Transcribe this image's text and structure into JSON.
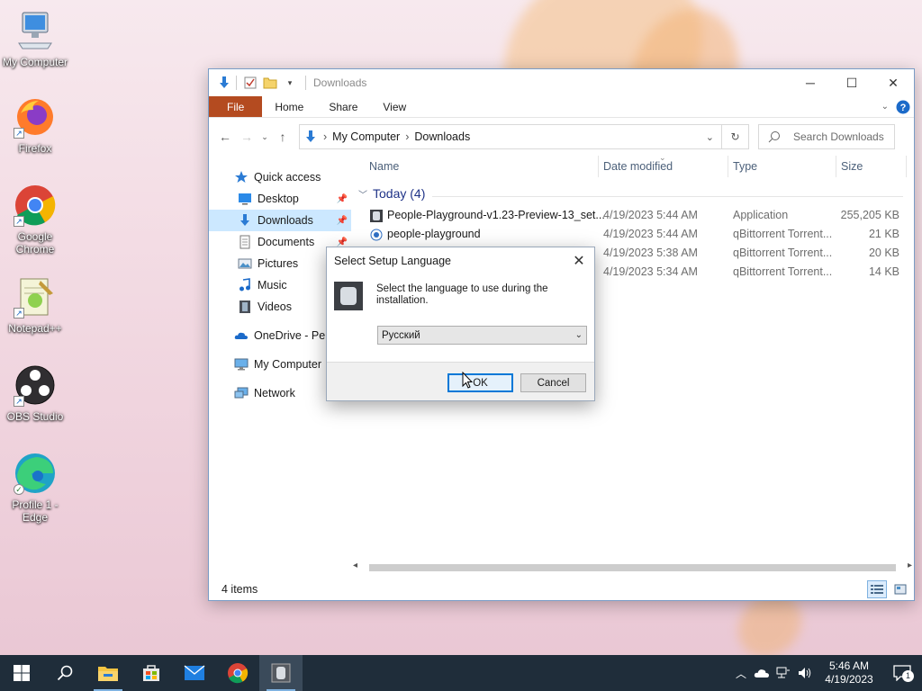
{
  "desktop": {
    "icons": [
      {
        "name": "my-computer",
        "label": "My Computer"
      },
      {
        "name": "firefox",
        "label": "Firefox"
      },
      {
        "name": "google-chrome",
        "label": "Google Chrome"
      },
      {
        "name": "notepadpp",
        "label": "Notepad++"
      },
      {
        "name": "obs-studio",
        "label": "OBS Studio"
      },
      {
        "name": "edge",
        "label": "Profile 1 - Edge"
      }
    ]
  },
  "explorer": {
    "title": "Downloads",
    "tabs": {
      "file": "File",
      "home": "Home",
      "share": "Share",
      "view": "View"
    },
    "address": {
      "root": "My Computer",
      "current": "Downloads"
    },
    "search_placeholder": "Search Downloads",
    "nav": {
      "quick_access": "Quick access",
      "desktop": "Desktop",
      "downloads": "Downloads",
      "documents": "Documents",
      "pictures": "Pictures",
      "music": "Music",
      "videos": "Videos",
      "onedrive": "OneDrive - Perso",
      "my_computer": "My Computer",
      "network": "Network"
    },
    "columns": {
      "name": "Name",
      "date": "Date modified",
      "type": "Type",
      "size": "Size"
    },
    "group_label": "Today (4)",
    "files": [
      {
        "name": "People-Playground-v1.23-Preview-13_set...",
        "date": "4/19/2023 5:44 AM",
        "type": "Application",
        "size": "255,205 KB"
      },
      {
        "name": "people-playground",
        "date": "4/19/2023 5:44 AM",
        "type": "qBittorrent Torrent...",
        "size": "21 KB"
      },
      {
        "name": "",
        "date": "4/19/2023 5:38 AM",
        "type": "qBittorrent Torrent...",
        "size": "20 KB"
      },
      {
        "name": "",
        "date": "4/19/2023 5:34 AM",
        "type": "qBittorrent Torrent...",
        "size": "14 KB"
      }
    ],
    "status": "4 items"
  },
  "dialog": {
    "title": "Select Setup Language",
    "message": "Select the language to use during the installation.",
    "selected_language": "Русский",
    "ok": "OK",
    "cancel": "Cancel"
  },
  "taskbar": {
    "time": "5:46 AM",
    "date": "4/19/2023",
    "notification_count": "1"
  },
  "colors": {
    "file_tab": "#b44b20",
    "taskbar": "#1f2d3a",
    "selection": "#cce8ff",
    "accent": "#0078d7"
  }
}
